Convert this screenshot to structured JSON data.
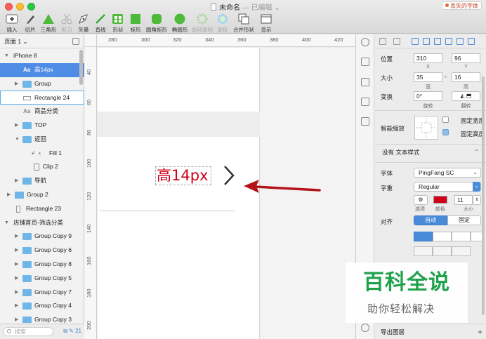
{
  "window": {
    "title": "未命名",
    "edited": "— 已编辑",
    "missing_fonts": "丢失的字体"
  },
  "toolbar": {
    "insert": "插入",
    "slice": "切片",
    "triangle": "三角形",
    "scissors": "剪刀",
    "vector": "矢量",
    "line": "直线",
    "shape": "形状",
    "rectangle": "矩形",
    "rounded_rect": "圆角矩形",
    "oval": "椭圆形",
    "rotate_copy": "旋转复制",
    "mask": "蒙板",
    "combine": "合并形状",
    "display": "显示"
  },
  "layers": {
    "page": "页面 1",
    "items": [
      {
        "label": "iPhone 8",
        "kind": "artboard"
      },
      {
        "label": "高14px",
        "kind": "text",
        "selected": true
      },
      {
        "label": "Group",
        "kind": "group"
      },
      {
        "label": "Rectangle 24",
        "kind": "rect",
        "hovered": true
      },
      {
        "label": "商品分类",
        "kind": "text"
      },
      {
        "label": "TOP",
        "kind": "group"
      },
      {
        "label": "返回",
        "kind": "group"
      },
      {
        "label": "Fill 1",
        "kind": "path"
      },
      {
        "label": "Clip 2",
        "kind": "clip"
      },
      {
        "label": "导航",
        "kind": "group"
      },
      {
        "label": "Group 2",
        "kind": "group"
      },
      {
        "label": "Rectangle 23",
        "kind": "rect"
      },
      {
        "label": "店铺首页-筛选分类",
        "kind": "artboard"
      },
      {
        "label": "Group Copy 9",
        "kind": "group"
      },
      {
        "label": "Group Copy 6",
        "kind": "group"
      },
      {
        "label": "Group Copy 8",
        "kind": "group"
      },
      {
        "label": "Group Copy 5",
        "kind": "group"
      },
      {
        "label": "Group Copy 7",
        "kind": "group"
      },
      {
        "label": "Group Copy 4",
        "kind": "group"
      },
      {
        "label": "Group Copy 3",
        "kind": "group"
      }
    ],
    "search_placeholder": "搜索",
    "count": "21"
  },
  "rulers": {
    "horizontal": [
      "280",
      "300",
      "320",
      "340",
      "360",
      "380",
      "400",
      "420"
    ],
    "vertical": [
      "40",
      "60",
      "80",
      "100",
      "120",
      "140",
      "160",
      "180",
      "200"
    ]
  },
  "canvas": {
    "selected_text": "高14px"
  },
  "inspector": {
    "position_label": "位置",
    "x": "310",
    "y": "96",
    "x_label": "X",
    "y_label": "Y",
    "size_label": "大小",
    "width": "35",
    "height": "16",
    "width_label": "宽",
    "height_label": "高",
    "transform_label": "变换",
    "rotation": "0°",
    "rotate_label": "旋转",
    "flip_label": "翻转",
    "smart_resize_label": "智能缩放",
    "fixed_width": "固定宽度",
    "fixed_height": "固定高度",
    "text_style": "没有 文本样式",
    "font_label": "字体",
    "font_value": "PingFang SC",
    "weight_label": "字重",
    "weight_value": "Regular",
    "options_label": "选项",
    "color_label": "颜色",
    "size_small_label": "大小",
    "font_size": "11",
    "align_label": "对齐",
    "auto": "自动",
    "fixed": "固定",
    "export_label": "导出图层",
    "text_color": "#d0021b"
  },
  "watermark": {
    "title": "百科全说",
    "subtitle": "助你轻松解决"
  }
}
